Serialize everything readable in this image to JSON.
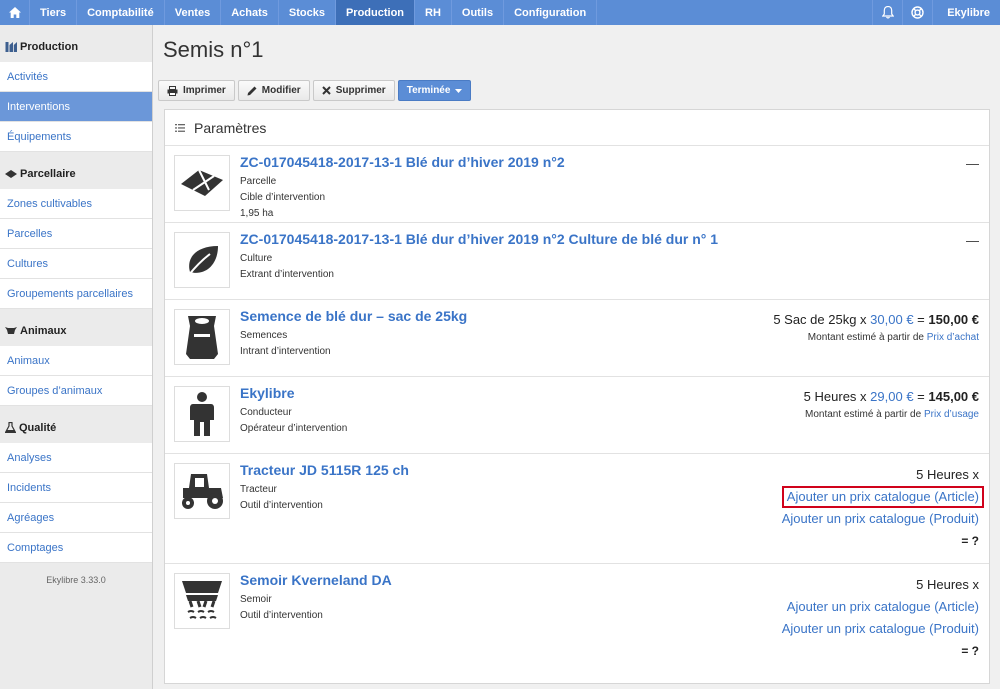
{
  "nav": {
    "items": [
      "Tiers",
      "Comptabilité",
      "Ventes",
      "Achats",
      "Stocks",
      "Production",
      "RH",
      "Outils",
      "Configuration"
    ],
    "active": "Production",
    "user": "Ekylibre"
  },
  "sidebar": {
    "sections": [
      {
        "title": "Production",
        "icon": "production-icon",
        "links": [
          "Activités",
          "Interventions",
          "Équipements"
        ]
      },
      {
        "title": "Parcellaire",
        "icon": "land-parcel-icon",
        "links": [
          "Zones cultivables",
          "Parcelles",
          "Cultures",
          "Groupements parcellaires"
        ]
      },
      {
        "title": "Animaux",
        "icon": "cow-icon",
        "links": [
          "Animaux",
          "Groupes d’animaux"
        ]
      },
      {
        "title": "Qualité",
        "icon": "flask-icon",
        "links": [
          "Analyses",
          "Incidents",
          "Agréages",
          "Comptages"
        ]
      }
    ],
    "active_link": "Interventions",
    "version": "Ekylibre 3.33.0"
  },
  "page": {
    "title": "Semis n°1",
    "toolbar": {
      "print": "Imprimer",
      "edit": "Modifier",
      "delete": "Supprimer",
      "state": "Terminée"
    },
    "panel_title": "Paramètres"
  },
  "rows": [
    {
      "name": "ZC-017045418-2017-13-1 Blé dur d’hiver 2019 n°2",
      "type": "Parcelle",
      "role": "Cible d’intervention",
      "extra": "1,95 ha",
      "icon": "land-parcel-icon",
      "right": "—"
    },
    {
      "name": "ZC-017045418-2017-13-1 Blé dur d’hiver 2019 n°2 Culture de blé dur n° 1",
      "type": "Culture",
      "role": "Extrant d’intervention",
      "icon": "leaf-icon",
      "right": "—"
    },
    {
      "name": "Semence de blé dur – sac de 25kg",
      "type": "Semences",
      "role": "Intrant d’intervention",
      "icon": "seed-bag-icon",
      "price": {
        "qty": "5 Sac de 25kg x",
        "unit": "30,00 €",
        "eq": "=",
        "total": "150,00 €",
        "note": "Montant estimé à partir de",
        "link": "Prix d’achat"
      }
    },
    {
      "name": "Ekylibre",
      "type": "Conducteur",
      "role": "Opérateur d’intervention",
      "icon": "person-icon",
      "price": {
        "qty": "5 Heures x",
        "unit": "29,00 €",
        "eq": "=",
        "total": "145,00 €",
        "note": "Montant estimé à partir de",
        "link": "Prix d’usage"
      }
    },
    {
      "name": "Tracteur JD 5115R 125 ch",
      "type": "Tracteur",
      "role": "Outil d’intervention",
      "icon": "tractor-icon",
      "catalog": {
        "qty": "5 Heures x",
        "article": "Ajouter un prix catalogue (Article)",
        "product": "Ajouter un prix catalogue (Produit)",
        "eq": "= ?"
      }
    },
    {
      "name": "Semoir Kverneland DA",
      "type": "Semoir",
      "role": "Outil d’intervention",
      "icon": "seeder-icon",
      "catalog": {
        "qty": "5 Heures x",
        "article": "Ajouter un prix catalogue (Article)",
        "product": "Ajouter un prix catalogue (Produit)",
        "eq": "= ?"
      }
    }
  ]
}
